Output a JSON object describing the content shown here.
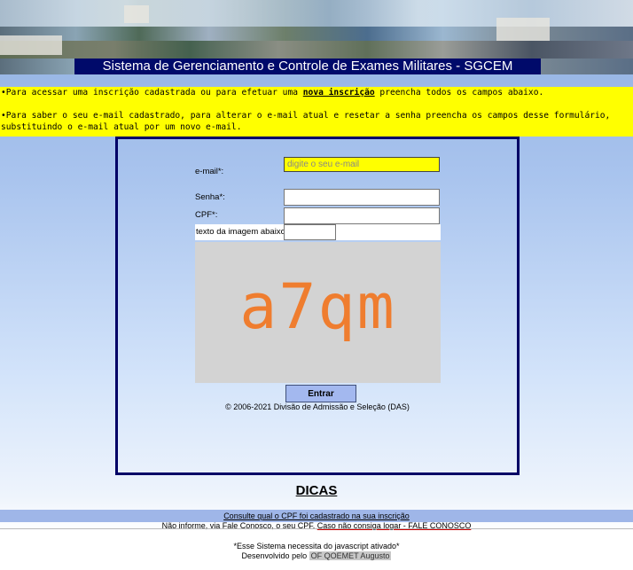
{
  "banner": {
    "title": "Sistema de Gerenciamento e Controle de Exames Militares - SGCEM"
  },
  "info": {
    "line1_before": "•Para acessar uma inscrição cadastrada ou para efetuar uma ",
    "line1_link": "nova inscrição",
    "line1_after": " preencha todos os campos abaixo.",
    "line2": "•Para saber o seu e-mail cadastrado, para alterar o e-mail atual e resetar a senha preencha os campos desse formulário,",
    "line3": "substituindo o e-mail atual por um novo e-mail."
  },
  "form": {
    "email_label": "e-mail*:",
    "email_placeholder": "digite o seu e-mail",
    "password_label": "Senha*:",
    "cpf_label": "CPF*:",
    "captcha_label": "texto da imagem abaixo:",
    "captcha_text": "a7qm",
    "submit_label": "Entrar",
    "copyright": "© 2006-2021 Divisão de Admissão e Seleção (DAS)"
  },
  "dicas": {
    "title": "DICAS",
    "tip1": "Consulte qual o CPF foi cadastrado na sua inscrição",
    "tip2_before": "Não informe, via Fale Conosco, o seu CPF. ",
    "tip2_link": "Caso não consiga logar - FALE CONOSCO"
  },
  "footer": {
    "js_note": "*Esse Sistema necessita do javascript ativado*",
    "dev_before": "Desenvolvido pelo ",
    "dev_name": "OF QOEMET Augusto"
  },
  "colors": {
    "title_bar": "#000a6a",
    "info_bg": "#ffff00",
    "panel_border": "#000066",
    "captcha_text": "#ef7d2f",
    "submit_bg": "#a3b8ef"
  }
}
